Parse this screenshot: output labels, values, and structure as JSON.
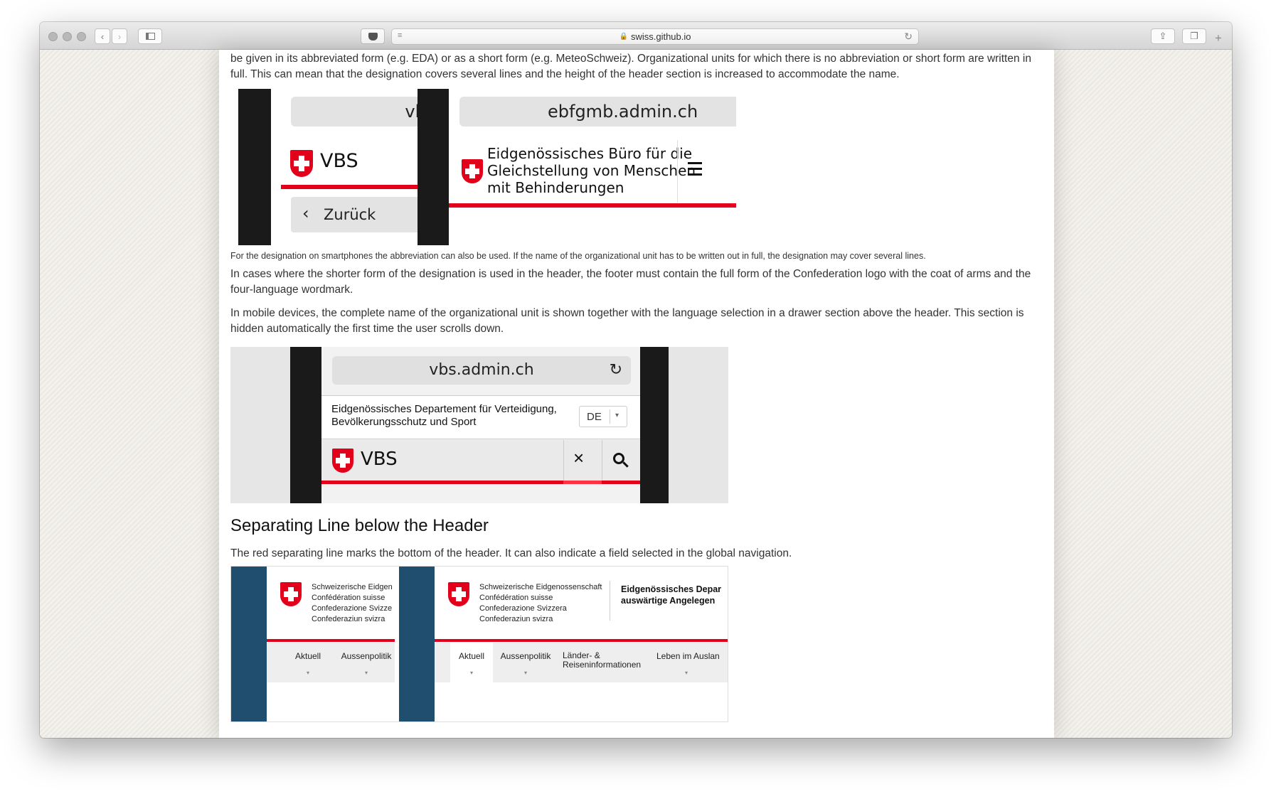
{
  "browser": {
    "url": "swiss.github.io",
    "colors": {
      "swiss_red": "#e2001a",
      "nav_blue": "#1f4e6e"
    }
  },
  "article": {
    "intro_text": "be given in its abbreviated form (e.g. EDA) or as a short form (e.g. MeteoSchweiz). Organizational units for which there is no abbreviation or short form are written in full. This can mean that the designation covers several lines and the height of the header section is increased to accommodate the name.",
    "figure1": {
      "url_short": "vbs.",
      "url_full": "ebfgmb.admin.ch",
      "abbr": "VBS",
      "back_label": "Zurück",
      "long_name": "Eidgenössisches Büro für die Gleichstellung von Menschen mit Behinderungen",
      "long_name_l1": "Eidgenössisches Büro für die",
      "long_name_l2": "Gleichstellung von Menschen",
      "long_name_l3": "mit Behinderungen",
      "menu_icon": "hamburger-icon"
    },
    "caption1": "For the designation on smartphones the abbreviation can also be used. If the name of the organizational unit has to be written out in full, the designation may cover several lines.",
    "para2": "In cases where the shorter form of the designation is used in the header, the footer must contain the full form of the Confederation logo with the coat of arms and the four-language wordmark.",
    "para3": "In mobile devices, the complete name of the organizational unit is shown together with the language selection in a drawer section above the header. This section is hidden automatically the first time the user scrolls down.",
    "figure2": {
      "url": "vbs.admin.ch",
      "drawer_l1": "Eidgenössisches Departement für Verteidigung,",
      "drawer_l2": "Bevölkerungsschutz und Sport",
      "lang": "DE",
      "abbr": "VBS",
      "close_icon": "close-icon",
      "search_icon": "search-icon"
    },
    "section_heading": "Separating Line below the Header",
    "section_text": "The red separating line marks the bottom of the header. It can also indicate a field selected in the global navigation.",
    "figure3": {
      "wordmark_cut": [
        "Schweizerische Eidgen",
        "Confédération suisse",
        "Confederazione Svizze",
        "Confederaziun svizra"
      ],
      "wordmark": [
        "Schweizerische Eidgenossenschaft",
        "Confédération suisse",
        "Confederazione Svizzera",
        "Confederaziun svizra"
      ],
      "dept_l1": "Eidgenössisches Depar",
      "dept_l2": "auswärtige Angelegen",
      "nav_back": [
        "Aktuell",
        "Aussenpolitik"
      ],
      "nav": [
        "Aktuell",
        "Aussenpolitik",
        "Länder- &\nReiseninformationen",
        "Leben im Auslan"
      ]
    }
  }
}
